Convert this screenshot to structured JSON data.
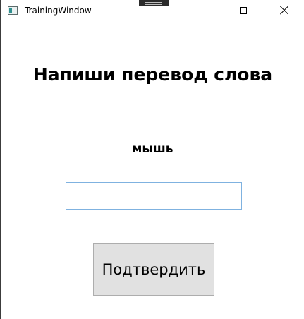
{
  "window": {
    "title": "TrainingWindow",
    "app_icon": "window-app-icon",
    "controls": {
      "minimize_icon": "minimize-icon",
      "maximize_icon": "maximize-icon",
      "close_icon": "close-icon"
    }
  },
  "main": {
    "heading": "Напиши перевод слова",
    "word": "мышь",
    "answer": {
      "value": "",
      "placeholder": ""
    },
    "confirm_label": "Подтвердить"
  },
  "colors": {
    "background": "#ffffff",
    "input_border": "#7fb2e0",
    "button_background": "#e1e1e1",
    "button_border": "#adadad",
    "text": "#000000"
  }
}
